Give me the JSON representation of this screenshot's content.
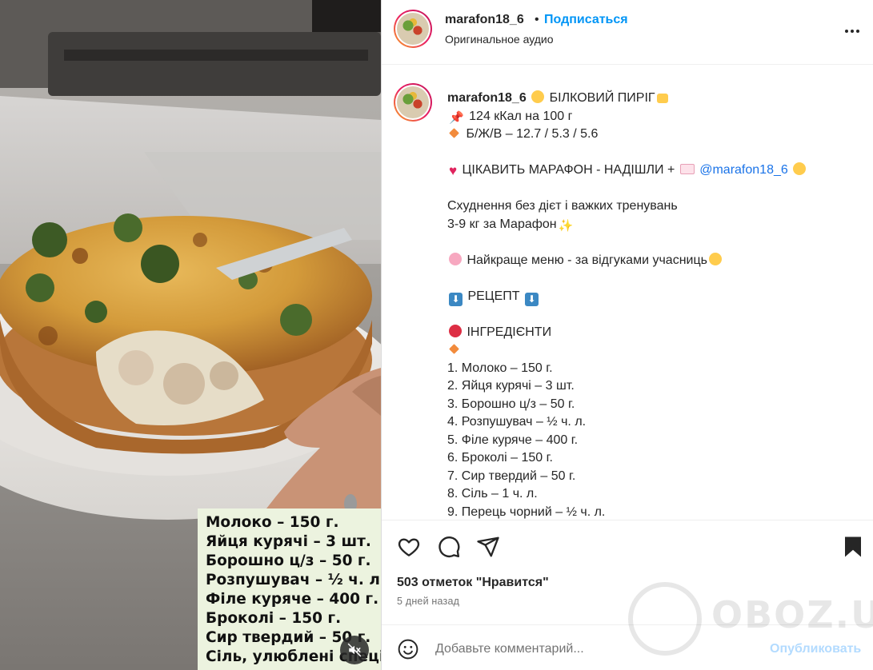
{
  "media": {
    "overlay_lines": [
      "Молоко – 150 г.",
      "Яйця курячі – 3 шт.",
      "Борошно ц/з – 50 г.",
      "Розпушувач – ½ ч. л.",
      "Філе куряче – 400 г.",
      "Броколі – 150 г.",
      "Сир твердий – 50 г.",
      "Сіль, улюблені спеції"
    ],
    "mute_icon": "speaker-muted-icon"
  },
  "header": {
    "username": "marafon18_6",
    "dot": "•",
    "follow_label": "Подписаться",
    "audio_label": "Оригинальное аудио",
    "more_icon": "more-options-icon"
  },
  "caption": {
    "username": "marafon18_6",
    "title": "БІЛКОВИЙ ПИРІГ",
    "kcal": "124 кКал на 100 г",
    "macros": "Б/Ж/В – 12.7 / 5.3 / 5.6",
    "cta": "ЦІКАВИТЬ МАРАФОН - НАДІШЛИ +",
    "mention": "@marafon18_6",
    "promo_line1": "Схуднення без дієт і важких тренувань",
    "promo_line2": "3-9 кг за Марафон",
    "menu_line": "Найкраще меню - за відгуками учасниць",
    "recipe_label": "РЕЦЕПТ",
    "ingredients_label": "ІНГРЕДІЄНТИ",
    "ingredients": [
      "1. Молоко – 150 г.",
      "2. Яйця курячі – 3 шт.",
      "3. Борошно ц/з – 50 г.",
      "4. Розпушувач – ½ ч. л.",
      "5. Філе куряче – 400 г.",
      "6. Броколі – 150 г.",
      "7. Сир твердий – 50 г.",
      "8. Сіль – 1 ч. л.",
      "9. Перець чорний – ½ ч. л."
    ]
  },
  "actions": {
    "icons": [
      "heart-icon",
      "comment-icon",
      "share-icon",
      "bookmark-icon"
    ]
  },
  "likes_text": "503 отметок \"Нравится\"",
  "posted_text": "5 дней назад",
  "comment": {
    "placeholder": "Добавьте комментарий...",
    "publish_label": "Опубликовать"
  },
  "watermark_text": "OBOZ.UA",
  "colors": {
    "link_blue": "#0095f6",
    "publish_disabled": "#b3dbff",
    "overlay_bg": "#ecf3df"
  }
}
